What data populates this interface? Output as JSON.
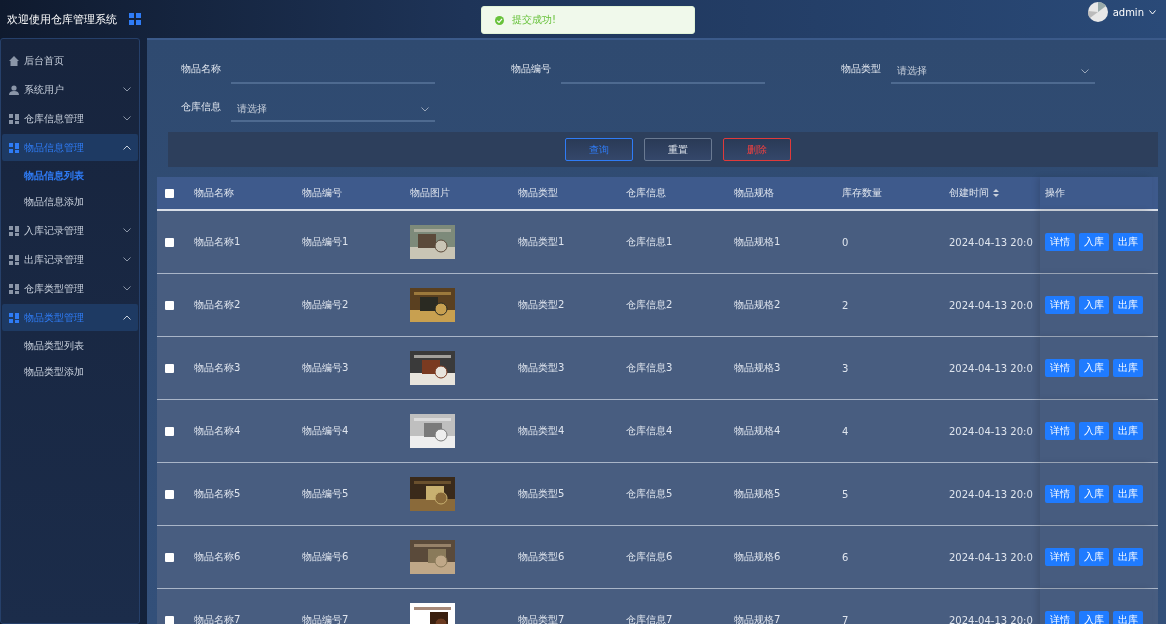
{
  "header": {
    "title": "欢迎使用仓库管理系统",
    "user": "admin"
  },
  "toast": {
    "message": "提交成功!"
  },
  "sidebar": {
    "items": [
      {
        "label": "后台首页",
        "expanded": false,
        "has_children": false
      },
      {
        "label": "系统用户",
        "expanded": false,
        "has_children": true
      },
      {
        "label": "仓库信息管理",
        "expanded": false,
        "has_children": true
      },
      {
        "label": "物品信息管理",
        "expanded": true,
        "has_children": true,
        "children": [
          {
            "label": "物品信息列表",
            "selected": true
          },
          {
            "label": "物品信息添加",
            "selected": false
          }
        ]
      },
      {
        "label": "入库记录管理",
        "expanded": false,
        "has_children": true
      },
      {
        "label": "出库记录管理",
        "expanded": false,
        "has_children": true
      },
      {
        "label": "仓库类型管理",
        "expanded": false,
        "has_children": true
      },
      {
        "label": "物品类型管理",
        "expanded": true,
        "has_children": true,
        "children": [
          {
            "label": "物品类型列表",
            "selected": false
          },
          {
            "label": "物品类型添加",
            "selected": false
          }
        ]
      }
    ]
  },
  "filters": [
    {
      "label": "物品名称",
      "kind": "input"
    },
    {
      "label": "物品编号",
      "kind": "input"
    },
    {
      "label": "物品类型",
      "kind": "select",
      "placeholder": "请选择"
    },
    {
      "label": "仓库信息",
      "kind": "select",
      "placeholder": "请选择"
    }
  ],
  "buttons": [
    {
      "label": "查询",
      "kind": "primary"
    },
    {
      "label": "重置",
      "kind": "default"
    },
    {
      "label": "删除",
      "kind": "danger"
    }
  ],
  "table": {
    "select_all": {
      "checked": false
    },
    "columns": [
      {
        "label": "物品名称",
        "sortable": false
      },
      {
        "label": "物品编号",
        "sortable": false
      },
      {
        "label": "物品图片",
        "sortable": false
      },
      {
        "label": "物品类型",
        "sortable": false
      },
      {
        "label": "仓库信息",
        "sortable": false
      },
      {
        "label": "物品规格",
        "sortable": false
      },
      {
        "label": "库存数量",
        "sortable": false
      },
      {
        "label": "创建时间",
        "sortable": true
      },
      {
        "label": "操作",
        "sortable": false
      }
    ],
    "rows": [
      {
        "checked": false,
        "name": "物品名称1",
        "code": "物品编号1",
        "image": {
          "kind": "picture"
        },
        "type": "物品类型1",
        "warehouse": "仓库信息1",
        "spec": "物品规格1",
        "stock": "0",
        "created": "2024-04-13 20:0",
        "actions": [
          "详情",
          "入库",
          "出库"
        ]
      },
      {
        "checked": false,
        "name": "物品名称2",
        "code": "物品编号2",
        "image": {
          "kind": "picture"
        },
        "type": "物品类型2",
        "warehouse": "仓库信息2",
        "spec": "物品规格2",
        "stock": "2",
        "created": "2024-04-13 20:0",
        "actions": [
          "详情",
          "入库",
          "出库"
        ]
      },
      {
        "checked": false,
        "name": "物品名称3",
        "code": "物品编号3",
        "image": {
          "kind": "picture"
        },
        "type": "物品类型3",
        "warehouse": "仓库信息3",
        "spec": "物品规格3",
        "stock": "3",
        "created": "2024-04-13 20:0",
        "actions": [
          "详情",
          "入库",
          "出库"
        ]
      },
      {
        "checked": false,
        "name": "物品名称4",
        "code": "物品编号4",
        "image": {
          "kind": "picture"
        },
        "type": "物品类型4",
        "warehouse": "仓库信息4",
        "spec": "物品规格4",
        "stock": "4",
        "created": "2024-04-13 20:0",
        "actions": [
          "详情",
          "入库",
          "出库"
        ]
      },
      {
        "checked": false,
        "name": "物品名称5",
        "code": "物品编号5",
        "image": {
          "kind": "picture"
        },
        "type": "物品类型5",
        "warehouse": "仓库信息5",
        "spec": "物品规格5",
        "stock": "5",
        "created": "2024-04-13 20:0",
        "actions": [
          "详情",
          "入库",
          "出库"
        ]
      },
      {
        "checked": false,
        "name": "物品名称6",
        "code": "物品编号6",
        "image": {
          "kind": "picture"
        },
        "type": "物品类型6",
        "warehouse": "仓库信息6",
        "spec": "物品规格6",
        "stock": "6",
        "created": "2024-04-13 20:0",
        "actions": [
          "详情",
          "入库",
          "出库"
        ]
      },
      {
        "checked": false,
        "name": "物品名称7",
        "code": "物品编号7",
        "image": {
          "kind": "picture"
        },
        "type": "物品类型7",
        "warehouse": "仓库信息7",
        "spec": "物品规格7",
        "stock": "7",
        "created": "2024-04-13 20:0",
        "actions": [
          "详情",
          "入库",
          "出库"
        ]
      }
    ]
  }
}
